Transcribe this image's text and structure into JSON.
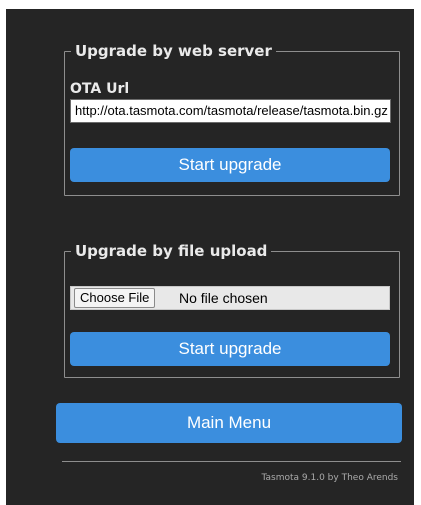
{
  "web_server": {
    "legend": "Upgrade by web server",
    "ota_label": "OTA Url",
    "ota_value": "http://ota.tasmota.com/tasmota/release/tasmota.bin.gz",
    "start_label": "Start upgrade"
  },
  "file_upload": {
    "legend": "Upgrade by file upload",
    "choose_label": "Choose File",
    "no_file_text": "No file chosen",
    "start_label": "Start upgrade"
  },
  "main_menu_label": "Main Menu",
  "footer_text": "Tasmota 9.1.0 by Theo Arends",
  "colors": {
    "background": "#252525",
    "button": "#3b8ede",
    "text": "#eaeaea"
  }
}
